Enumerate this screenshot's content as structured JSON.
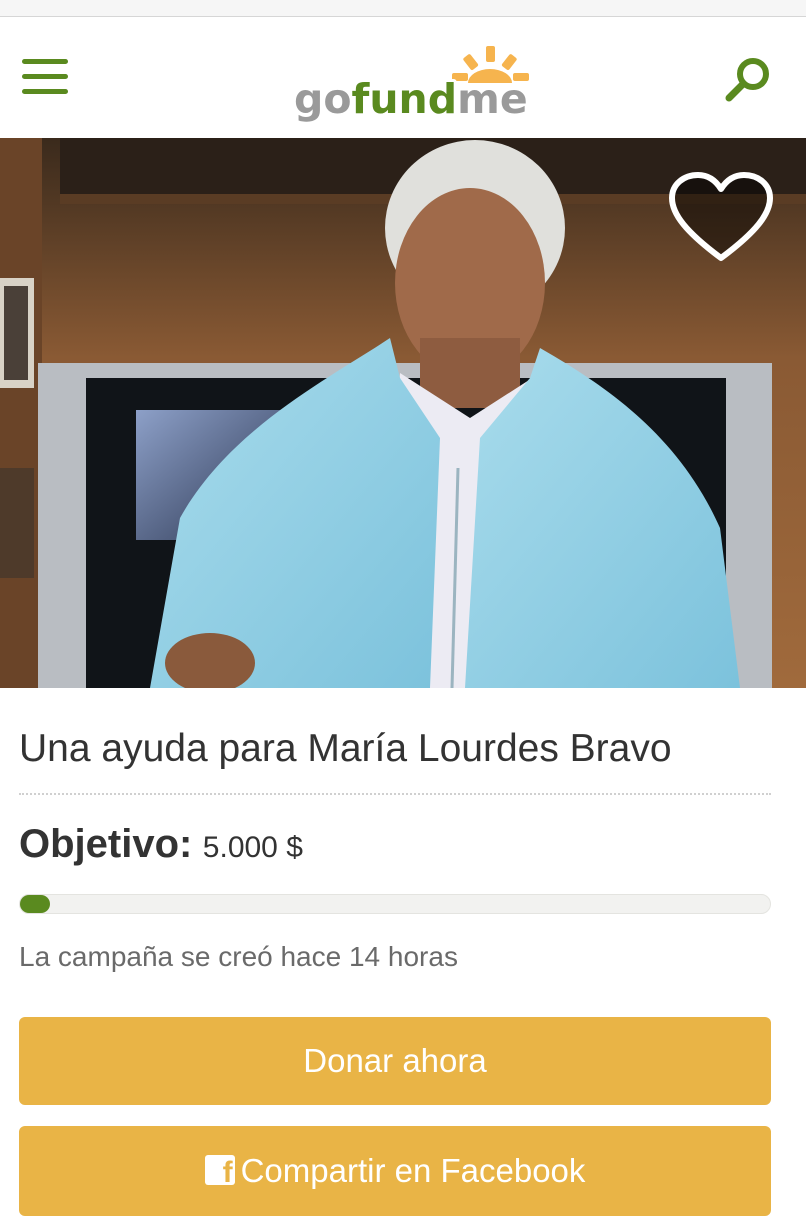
{
  "header": {
    "logo_text": "gofundme",
    "menu_icon": "hamburger-menu-icon",
    "search_icon": "search-icon",
    "brand_color": "#5a8a1f",
    "logo_sun_color": "#f6b44e"
  },
  "hero": {
    "image": "photo-elderly-woman-light-blue-jacket",
    "favorite_icon": "heart-icon"
  },
  "campaign": {
    "title": "Una ayuda para María Lourdes Bravo",
    "goal_label": "Objetivo:",
    "goal_value": "5.000 $",
    "progress_fraction": 0.02,
    "created_text": "La campaña se creó hace 14 horas"
  },
  "actions": {
    "donate_label": "Donar ahora",
    "share_label": "Compartir en Facebook",
    "share_icon": "facebook-icon",
    "button_color": "#e9b446"
  }
}
